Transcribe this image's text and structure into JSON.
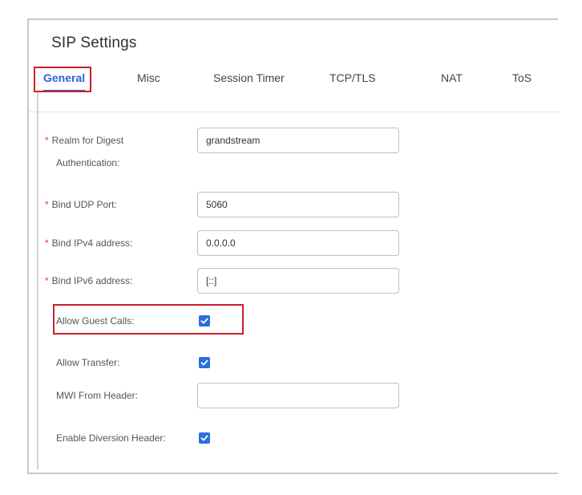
{
  "page": {
    "title": "SIP Settings"
  },
  "tabs": [
    {
      "label": "General",
      "active": true
    },
    {
      "label": "Misc"
    },
    {
      "label": "Session Timer"
    },
    {
      "label": "TCP/TLS"
    },
    {
      "label": "NAT"
    },
    {
      "label": "ToS"
    }
  ],
  "form": {
    "required_mark": "*",
    "realm": {
      "label_line1": "Realm for Digest",
      "label_line2": "Authentication:",
      "value": "grandstream"
    },
    "bind_udp_port": {
      "label": "Bind UDP Port:",
      "value": "5060"
    },
    "bind_ipv4": {
      "label": "Bind IPv4 address:",
      "value": "0.0.0.0"
    },
    "bind_ipv6": {
      "label": "Bind IPv6 address:",
      "value": "[::]"
    },
    "allow_guest_calls": {
      "label": "Allow Guest Calls:",
      "checked": true
    },
    "allow_transfer": {
      "label": "Allow Transfer:",
      "checked": true
    },
    "mwi_from_header": {
      "label": "MWI From Header:",
      "value": ""
    },
    "enable_diversion_header": {
      "label": "Enable Diversion Header:",
      "checked": true
    }
  },
  "colors": {
    "accent": "#2b62d6",
    "highlight": "#cc1f2b",
    "required": "#e0383e",
    "checkbox": "#2b6ee0"
  }
}
